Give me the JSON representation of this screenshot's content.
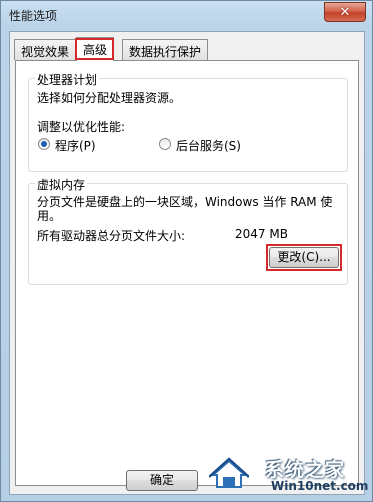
{
  "window": {
    "title": "性能选项",
    "close_glyph": "✕"
  },
  "tabs": [
    {
      "label": "视觉效果",
      "active": false
    },
    {
      "label": "高级",
      "active": true
    },
    {
      "label": "数据执行保护",
      "active": false
    }
  ],
  "processor": {
    "group_title": "处理器计划",
    "description": "选择如何分配处理器资源。",
    "optimize_label": "调整以优化性能:",
    "options": [
      {
        "label": "程序(P)",
        "checked": true
      },
      {
        "label": "后台服务(S)",
        "checked": false
      }
    ]
  },
  "virtual_memory": {
    "group_title": "虚拟内存",
    "description_line1": "分页文件是硬盘上的一块区域，Windows 当作 RAM 使",
    "description_line2": "用。",
    "total_label": "所有驱动器总分页文件大小:",
    "total_value": "2047 MB",
    "change_button": "更改(C)..."
  },
  "footer": {
    "ok_button": "确定"
  },
  "watermark": {
    "main": "系统之家",
    "sub": "Win10net.com"
  },
  "colors": {
    "highlight": "#d42a2a",
    "radio_dot": "#1b5fb5"
  }
}
